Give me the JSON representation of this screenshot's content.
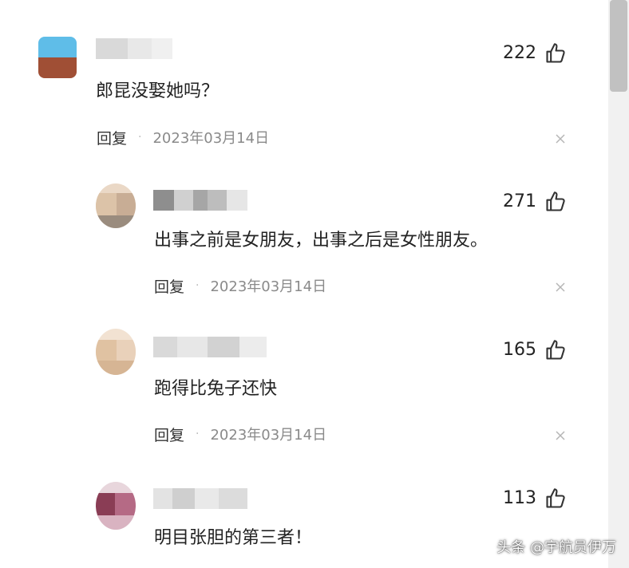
{
  "comments": [
    {
      "text": "郎昆没娶她吗？",
      "likes": "222",
      "reply_label": "回复",
      "separator": "·",
      "date": "2023年03月14日"
    },
    {
      "text": "出事之前是女朋友，出事之后是女性朋友。",
      "likes": "271",
      "reply_label": "回复",
      "separator": "·",
      "date": "2023年03月14日"
    },
    {
      "text": "跑得比兔子还快",
      "likes": "165",
      "reply_label": "回复",
      "separator": "·",
      "date": "2023年03月14日"
    },
    {
      "text": "明目张胆的第三者！",
      "likes": "113"
    }
  ],
  "watermark": "头条 @宇航员伊万",
  "icons": {
    "like": "thumbs-up-icon",
    "close": "close-icon"
  },
  "colors": {
    "text": "#222222",
    "date": "#8a8a8a",
    "icon": "#333333"
  }
}
